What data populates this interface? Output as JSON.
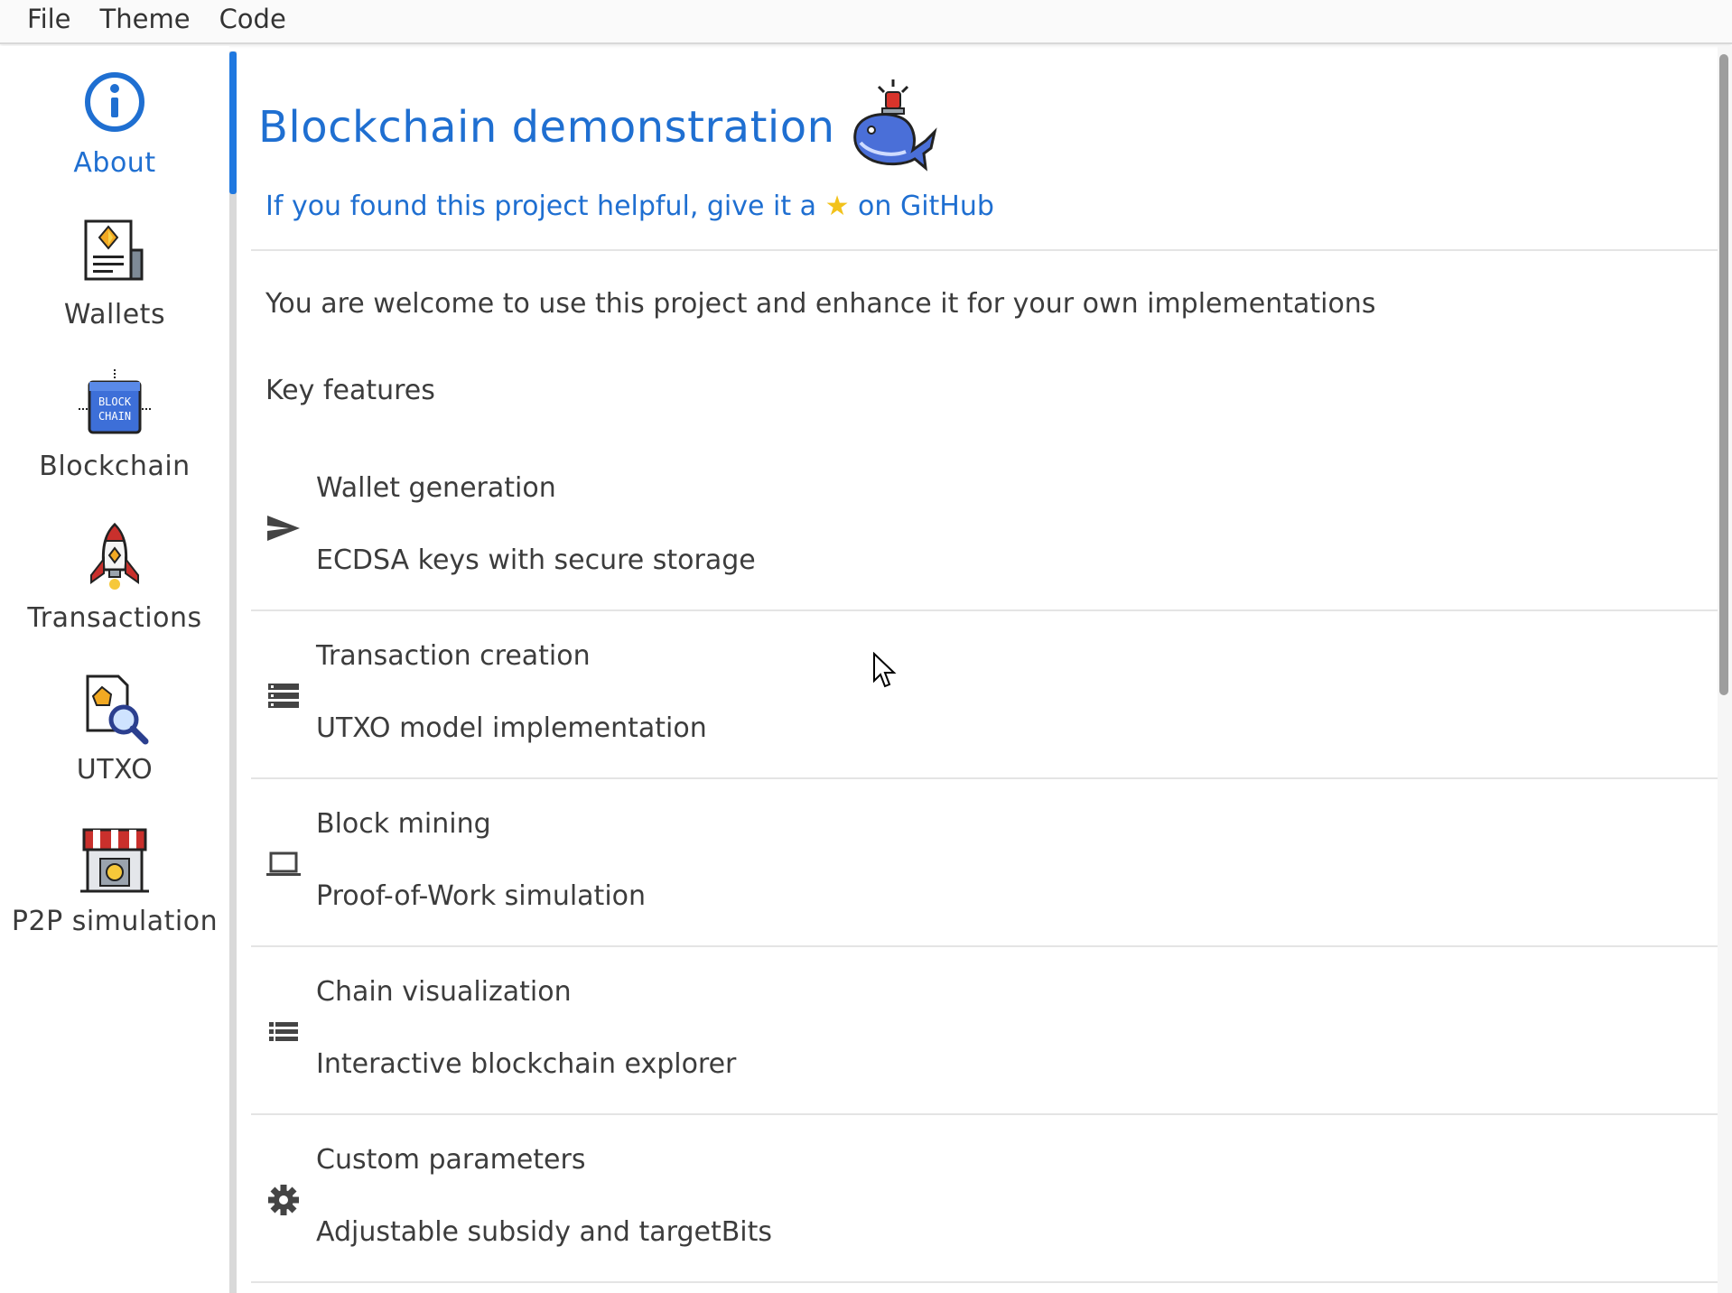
{
  "menu": [
    "File",
    "Theme",
    "Code"
  ],
  "sidebar": {
    "items": [
      {
        "label": "About",
        "icon": "info-icon",
        "active": true
      },
      {
        "label": "Wallets",
        "icon": "wallet-document-icon",
        "active": false
      },
      {
        "label": "Blockchain",
        "icon": "blockchain-cube-icon",
        "active": false
      },
      {
        "label": "Transactions",
        "icon": "rocket-icon",
        "active": false
      },
      {
        "label": "UTXO",
        "icon": "magnifier-document-icon",
        "active": false
      },
      {
        "label": "P2P simulation",
        "icon": "shop-icon",
        "active": false
      }
    ]
  },
  "main": {
    "title": "Blockchain demonstration",
    "title_image": "whale-siren-icon",
    "github_text_before": "If you found this project helpful, give it a",
    "github_star": "★",
    "github_text_after": "on GitHub",
    "welcome": "You are welcome to use this project and enhance it for your own implementations",
    "key_features_heading": "Key features",
    "features": [
      {
        "title": "Wallet generation",
        "description": "ECDSA keys with secure storage",
        "icon": "send-icon"
      },
      {
        "title": "Transaction creation",
        "description": "UTXO model implementation",
        "icon": "storage-icon"
      },
      {
        "title": "Block mining",
        "description": "Proof-of-Work simulation",
        "icon": "laptop-icon"
      },
      {
        "title": "Chain visualization",
        "description": "Interactive blockchain explorer",
        "icon": "list-icon"
      },
      {
        "title": "Custom parameters",
        "description": "Adjustable subsidy and targetBits",
        "icon": "gear-icon"
      }
    ]
  },
  "colors": {
    "accent": "#1f6fd1",
    "star": "#f2c21b",
    "text": "#3c3c3c",
    "divider": "#e4e4e4"
  }
}
